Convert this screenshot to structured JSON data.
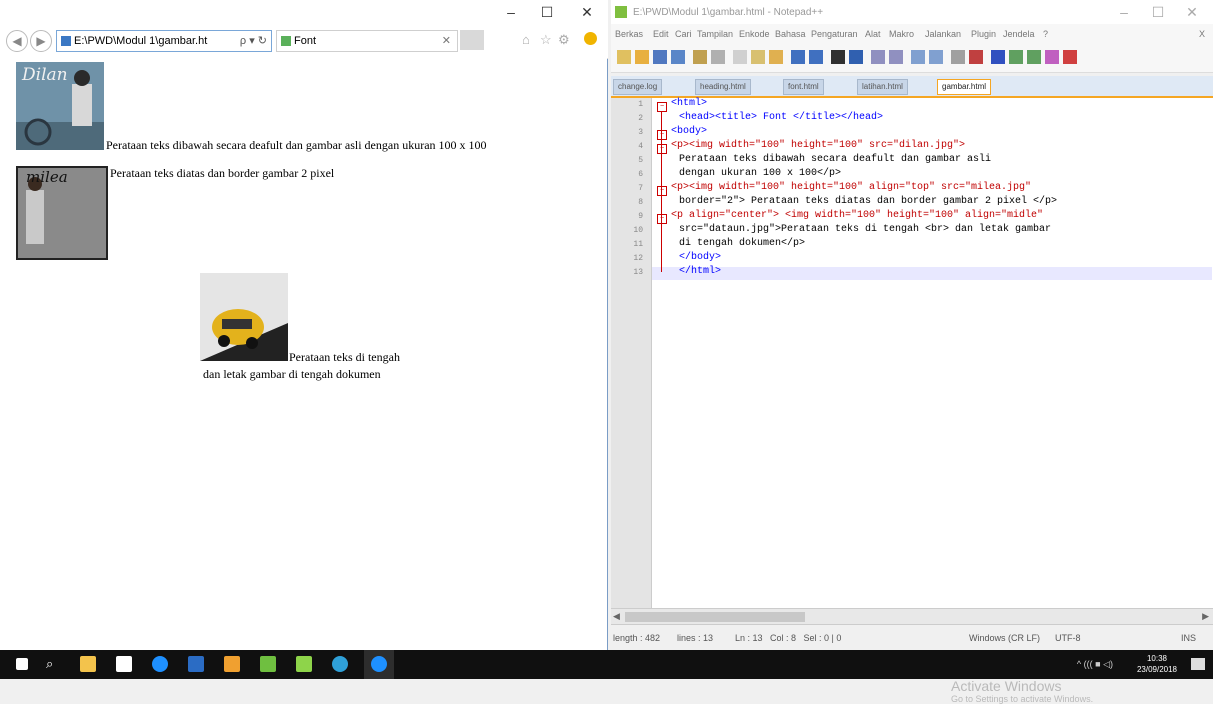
{
  "ie": {
    "window_controls": {
      "minimize": "–",
      "maximize": "☐",
      "close": "✕"
    },
    "address": "E:\\PWD\\Modul 1\\gambar.ht",
    "address_icons": "ρ ▾ ↻",
    "tab_title": "Font",
    "tab_close": "✕",
    "content": {
      "p1_text": "Perataan teks dibawah secara deafult dan gambar asli dengan ukuran 100 x 100",
      "p2_text": "Perataan teks diatas dan border gambar 2 pixel",
      "p3_line1": "Perataan teks di tengah",
      "p3_line2": "dan letak gambar di tengah dokumen",
      "img1_label": "Dilan",
      "img2_label": "milea"
    }
  },
  "npp": {
    "title": "E:\\PWD\\Modul 1\\gambar.html - Notepad++",
    "window_controls": {
      "minimize": "–",
      "maximize": "☐",
      "close": "✕"
    },
    "menu": [
      "Berkas",
      "Edit",
      "Cari",
      "Tampilan",
      "Enkode",
      "Bahasa",
      "Pengaturan",
      "Alat",
      "Makro",
      "Jalankan",
      "Plugin",
      "Jendela",
      "?"
    ],
    "menu_close": "X",
    "tabs": [
      "change.log",
      "heading.html",
      "font.html",
      "latihan.html",
      "gambar.html"
    ],
    "active_tab": "gambar.html",
    "line_numbers": [
      "1",
      "2",
      "3",
      "4",
      "5",
      "6",
      "7",
      "8",
      "9",
      "10",
      "11",
      "12",
      "13"
    ],
    "code": [
      "<html>",
      "<head><title> Font </title></head>",
      "<body>",
      "<p><img width=\"100\" height=\"100\" src=\"dilan.jpg\">",
      "Perataan teks dibawah secara deafult dan gambar asli",
      "dengan ukuran 100 x 100</p>",
      "<p><img width=\"100\" height=\"100\" align=\"top\" src=\"milea.jpg\"",
      "border=\"2\"> Perataan teks diatas dan border gambar 2 pixel </p>",
      "<p align=\"center\"> <img width=\"100\" height=\"100\" align=\"midle\"",
      "src=\"dataun.jpg\">Perataan teks di tengah <br> dan letak gambar",
      "di tengah dokumen</p>",
      "</body>",
      "</html>"
    ],
    "status": {
      "length": "length : 482",
      "lines": "lines : 13",
      "position": "Ln : 13   Col : 8   Sel : 0 | 0",
      "eol": "Windows (CR LF)",
      "encoding": "UTF-8",
      "mode": "INS"
    },
    "watermark_title": "Activate Windows",
    "watermark_sub": "Go to Settings to activate Windows."
  },
  "taskbar": {
    "time": "10:38",
    "date": "23/09/2018",
    "tray_text": "^ ((( ■ ◁)"
  },
  "colors": {
    "taskbar_bg": "#101010",
    "tab_accent": "#f5a623",
    "html_tag": "#0000ff",
    "html_attr": "#c00000",
    "html_value": "#8000ff"
  }
}
